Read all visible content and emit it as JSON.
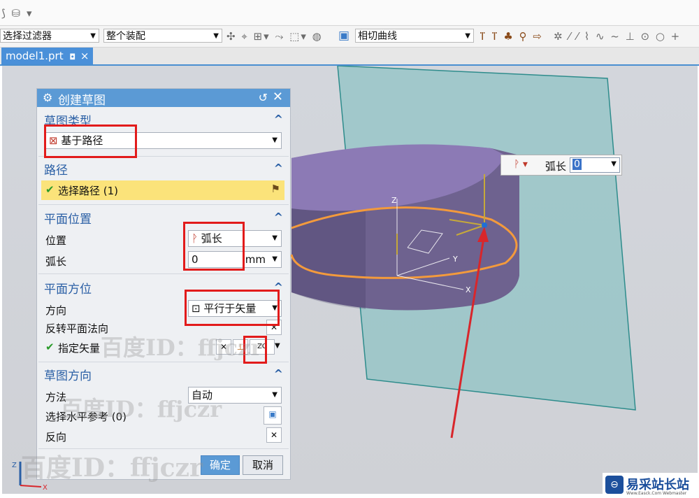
{
  "toolbar": {
    "filter_combo": "选择过滤器",
    "assembly_combo": "整个装配",
    "curve_combo": "相切曲线"
  },
  "file_tab": {
    "label": "model1.prt",
    "close": "×"
  },
  "dialog": {
    "title": "创建草图",
    "sections": {
      "sketch_type": {
        "header": "草图类型",
        "value": "基于路径"
      },
      "path": {
        "header": "路径",
        "select_label": "选择路径 (1)"
      },
      "plane_position": {
        "header": "平面位置",
        "position_label": "位置",
        "position_value": "弧长",
        "arc_label": "弧长",
        "arc_value": "0",
        "arc_unit": "mm"
      },
      "plane_orientation": {
        "header": "平面方位",
        "direction_label": "方向",
        "direction_value": "平行于矢量",
        "reverse_label": "反转平面法向",
        "vector_label": "指定矢量",
        "vector_icon_text": "ZC"
      },
      "sketch_orientation": {
        "header": "草图方向",
        "method_label": "方法",
        "method_value": "自动",
        "horizontal_ref_label": "选择水平参考 (0)",
        "reverse_label": "反向"
      }
    },
    "ok_button": "确定",
    "cancel_button": "取消"
  },
  "floating_input": {
    "label": "弧长",
    "value": "0"
  },
  "axes": {
    "x": "X",
    "y": "Y",
    "z": "Z"
  },
  "watermark": {
    "text": "百度ID：ffjczr"
  },
  "site_logo": {
    "text": "易采站长站",
    "sub": "Www.Easck.Com  Webmaster"
  }
}
